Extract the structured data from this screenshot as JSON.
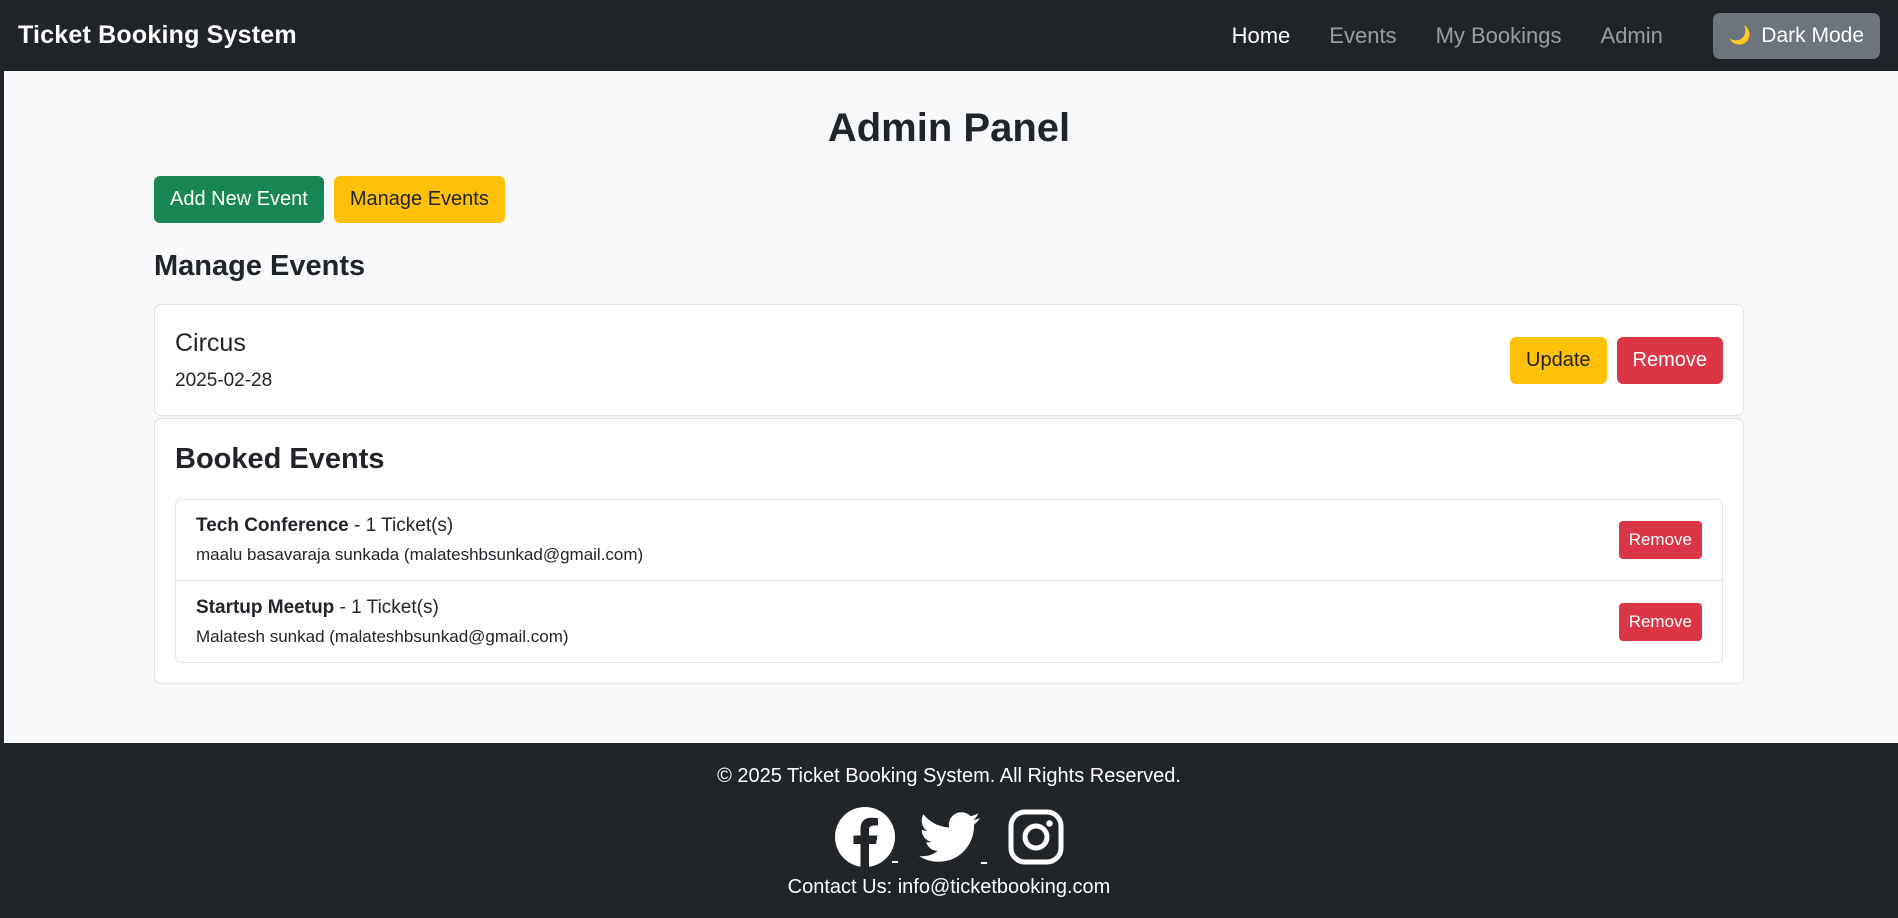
{
  "navbar": {
    "brand": "Ticket Booking System",
    "links": [
      {
        "label": "Home"
      },
      {
        "label": "Events"
      },
      {
        "label": "My Bookings"
      },
      {
        "label": "Admin"
      }
    ],
    "dark_mode_label": "Dark Mode",
    "dark_mode_icon": "moon-icon"
  },
  "main": {
    "title": "Admin Panel",
    "add_event_label": "Add New Event",
    "manage_events_label": "Manage Events",
    "section_title": "Manage Events",
    "events": [
      {
        "name": "Circus",
        "date": "2025-02-28",
        "update_label": "Update",
        "remove_label": "Remove"
      }
    ],
    "booked_title": "Booked Events",
    "bookings": [
      {
        "event": "Tech Conference",
        "tickets": " - 1 Ticket(s)",
        "user": "maalu basavaraja sunkada (malateshbsunkad@gmail.com)",
        "remove_label": "Remove"
      },
      {
        "event": "Startup Meetup",
        "tickets": " - 1 Ticket(s)",
        "user": "Malatesh sunkad (malateshbsunkad@gmail.com)",
        "remove_label": "Remove"
      }
    ]
  },
  "footer": {
    "copyright": "© 2025 Ticket Booking System. All Rights Reserved.",
    "social_icons": [
      "facebook-icon",
      "twitter-icon",
      "instagram-icon"
    ],
    "contact": "Contact Us: info@ticketbooking.com"
  },
  "colors": {
    "navbar_bg": "#212529",
    "success": "#198754",
    "warning": "#ffc107",
    "danger": "#dc3545",
    "secondary": "#6c757d"
  }
}
